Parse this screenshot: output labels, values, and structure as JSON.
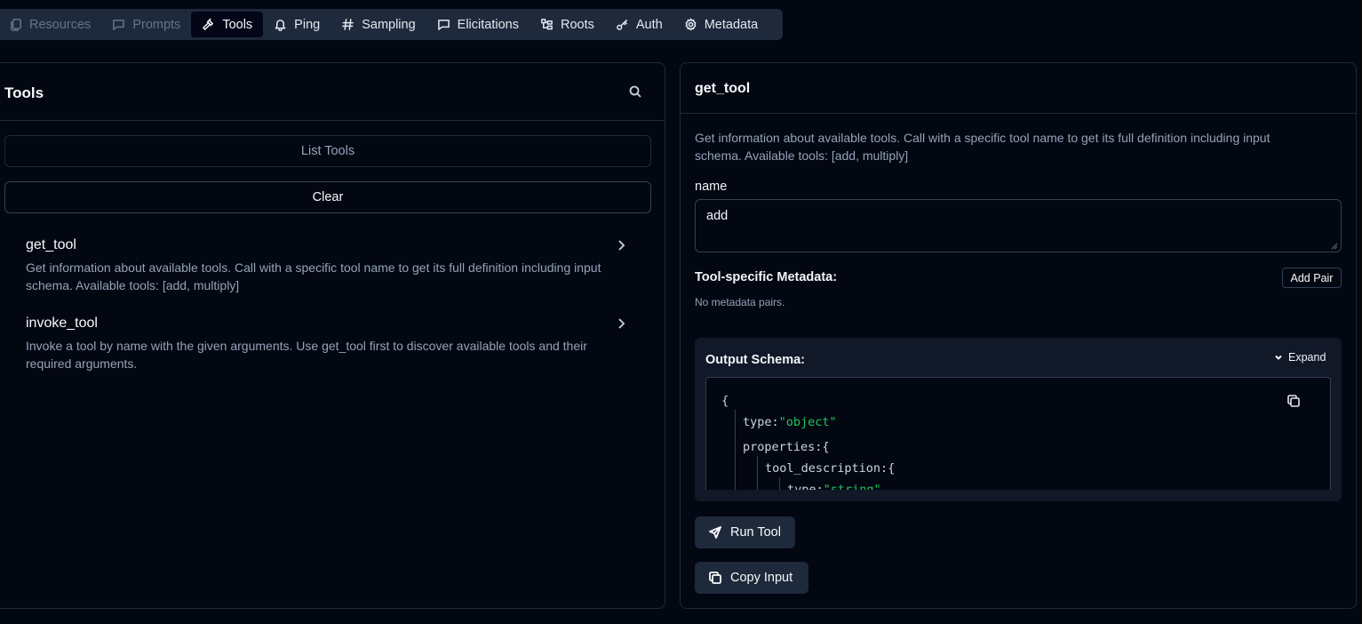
{
  "tabs": [
    {
      "label": "Resources",
      "icon": "files-icon",
      "state": "dim"
    },
    {
      "label": "Prompts",
      "icon": "message-icon",
      "state": "dim"
    },
    {
      "label": "Tools",
      "icon": "hammer-icon",
      "state": "active"
    },
    {
      "label": "Ping",
      "icon": "bell-icon",
      "state": "normal"
    },
    {
      "label": "Sampling",
      "icon": "hash-icon",
      "state": "normal"
    },
    {
      "label": "Elicitations",
      "icon": "message-icon",
      "state": "normal"
    },
    {
      "label": "Roots",
      "icon": "folder-tree-icon",
      "state": "normal"
    },
    {
      "label": "Auth",
      "icon": "key-icon",
      "state": "normal"
    },
    {
      "label": "Metadata",
      "icon": "gear-icon",
      "state": "normal"
    }
  ],
  "tools_panel": {
    "title": "Tools",
    "list_button": "List Tools",
    "clear_button": "Clear",
    "items": [
      {
        "name": "get_tool",
        "description": "Get information about available tools. Call with a specific tool name to get its full definition including input schema. Available tools: [add, multiply]"
      },
      {
        "name": "invoke_tool",
        "description": "Invoke a tool by name with the given arguments. Use get_tool first to discover available tools and their required arguments."
      }
    ]
  },
  "detail_panel": {
    "title": "get_tool",
    "description": "Get information about available tools. Call with a specific tool name to get its full definition including input schema. Available tools: [add, multiply]",
    "name_label": "name",
    "name_value": "add",
    "metadata_label": "Tool-specific Metadata:",
    "add_pair_button": "Add Pair",
    "no_metadata": "No metadata pairs.",
    "output_schema_label": "Output Schema:",
    "expand_button": "Expand",
    "schema_lines": {
      "open_brace": "{",
      "type_key": "type:",
      "type_value": "\"object\"",
      "properties_key": "properties:",
      "properties_brace": "{",
      "tool_description_key": "tool_description:",
      "tool_description_brace": "{",
      "inner_type_key": "type:",
      "inner_type_value": "\"string\""
    },
    "run_button": "Run Tool",
    "copy_button": "Copy Input"
  }
}
